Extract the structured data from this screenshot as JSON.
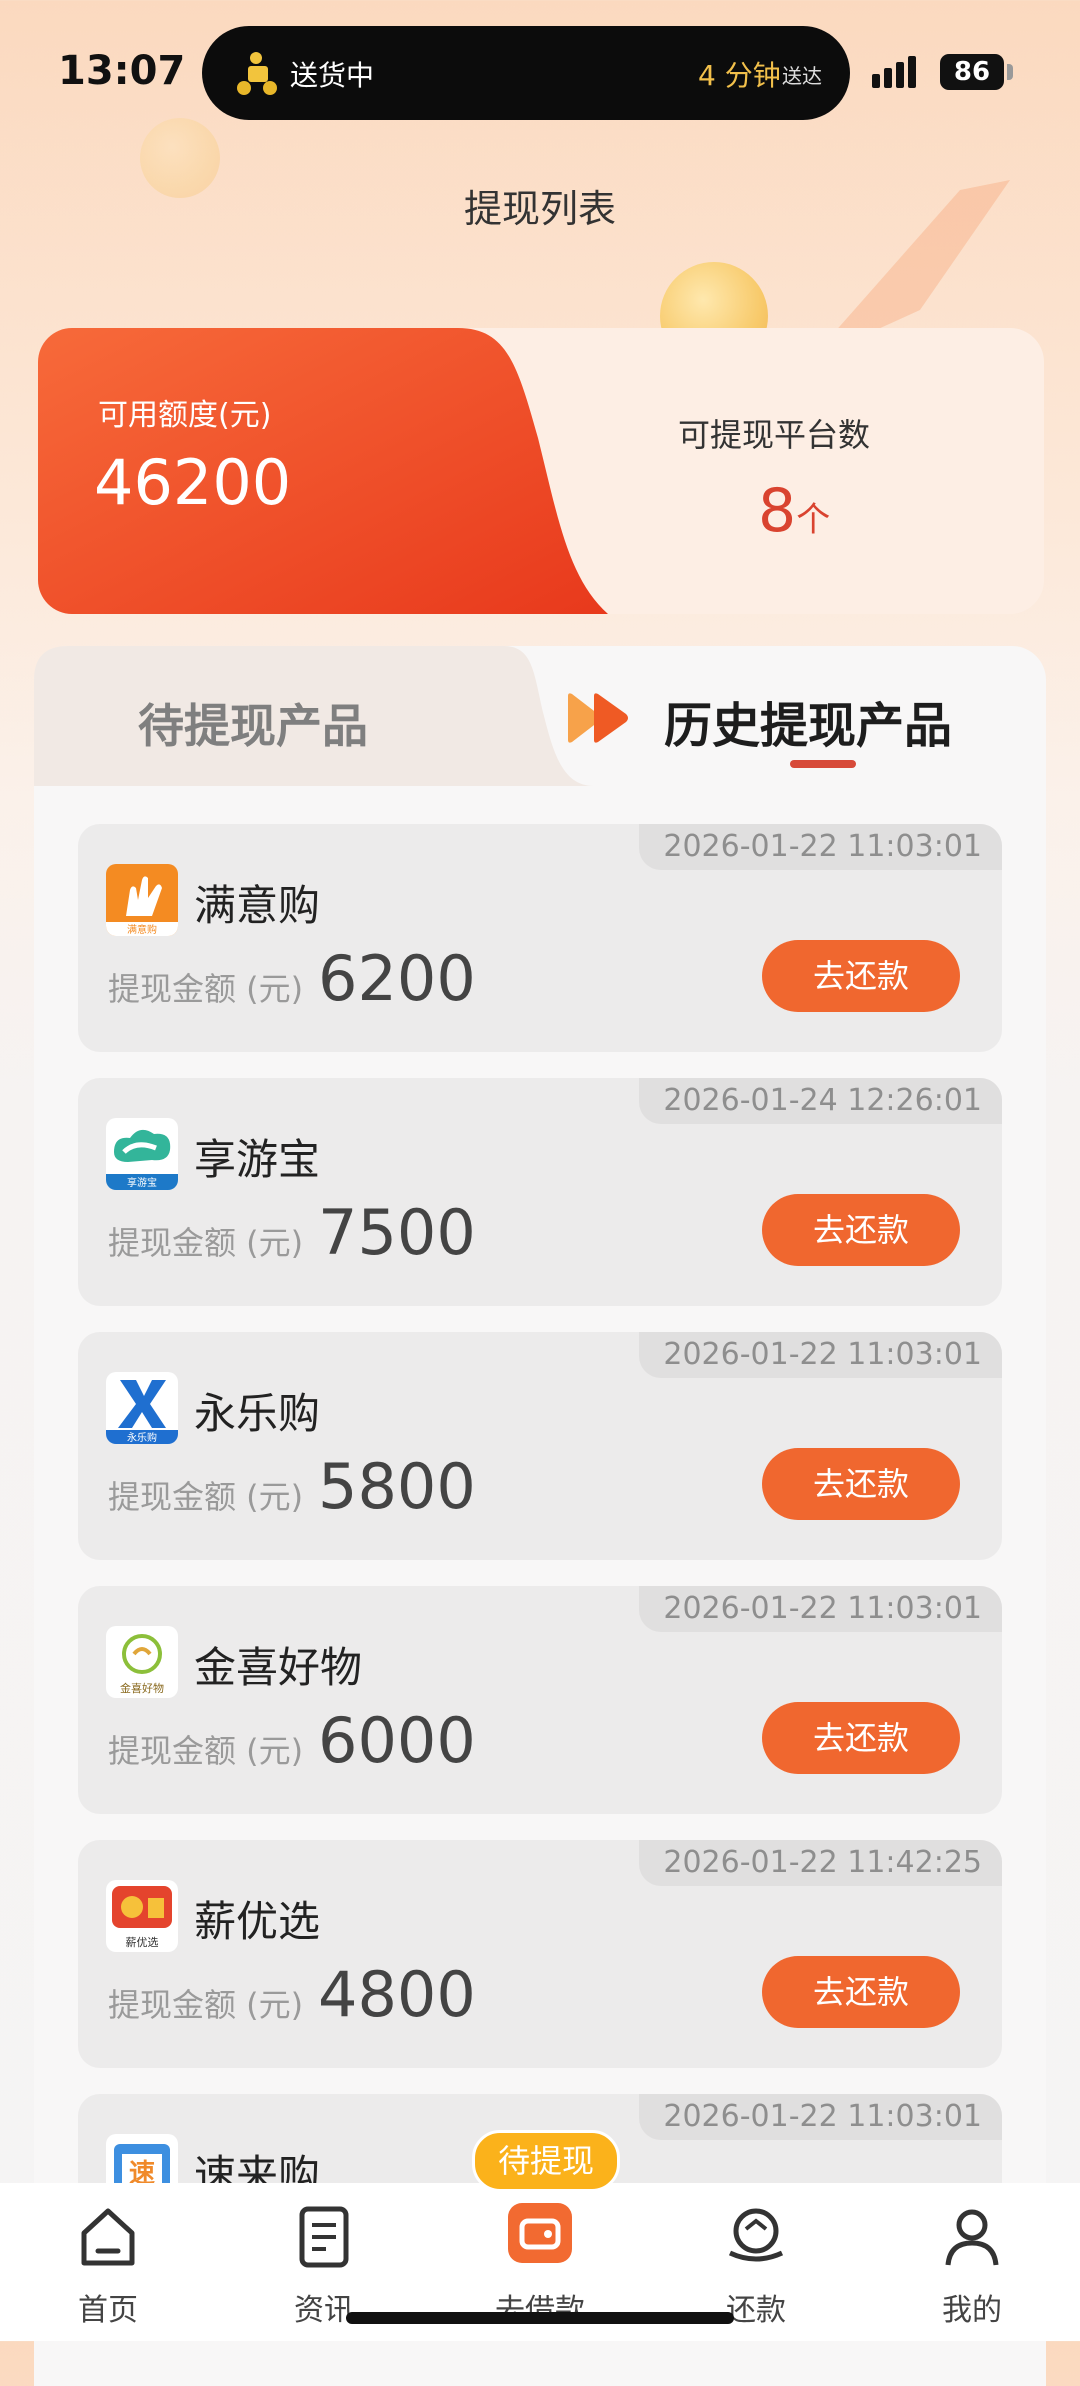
{
  "status_bar": {
    "time": "13:07",
    "delivery_text": "送货中",
    "eta": "4 分钟",
    "eta_suffix": "送达",
    "battery": "86"
  },
  "page": {
    "title": "提现列表"
  },
  "summary": {
    "credit_label": "可用额度(元)",
    "credit_value": "46200",
    "platform_label": "可提现平台数",
    "platform_value": "8",
    "platform_unit": "个",
    "colors": {
      "accent": "#ee4a22",
      "value": "#d9432f"
    }
  },
  "tabs": [
    {
      "label": "待提现产品",
      "active": false
    },
    {
      "label": "历史提现产品",
      "active": true
    }
  ],
  "list": {
    "amount_label": "提现金额 (元)",
    "button_label": "去还款",
    "items": [
      {
        "name": "满意购",
        "date": "2026-01-22 11:03:01",
        "amount": "6200",
        "logo_text": "满意购",
        "icon": "hand-logo-icon"
      },
      {
        "name": "享游宝",
        "date": "2026-01-24 12:26:01",
        "amount": "7500",
        "logo_text": "享游宝",
        "icon": "cloud-logo-icon"
      },
      {
        "name": "永乐购",
        "date": "2026-01-22 11:03:01",
        "amount": "5800",
        "logo_text": "永乐购",
        "icon": "x-logo-icon"
      },
      {
        "name": "金喜好物",
        "date": "2026-01-22 11:03:01",
        "amount": "6000",
        "logo_text": "金喜好物",
        "icon": "bag-logo-icon"
      },
      {
        "name": "薪优选",
        "date": "2026-01-22 11:42:25",
        "amount": "4800",
        "logo_text": "薪优选",
        "icon": "gift-logo-icon"
      },
      {
        "name": "速来购",
        "date": "2026-01-22 11:03:01",
        "amount": "",
        "logo_text": "速",
        "icon": "bag-blue-logo-icon"
      }
    ]
  },
  "bottom_nav": {
    "badge": "待提现",
    "items": [
      {
        "label": "首页",
        "icon": "home-icon"
      },
      {
        "label": "资讯",
        "icon": "document-icon"
      },
      {
        "label": "去借款",
        "icon": "wallet-icon"
      },
      {
        "label": "还款",
        "icon": "repay-icon"
      },
      {
        "label": "我的",
        "icon": "user-icon"
      }
    ]
  }
}
